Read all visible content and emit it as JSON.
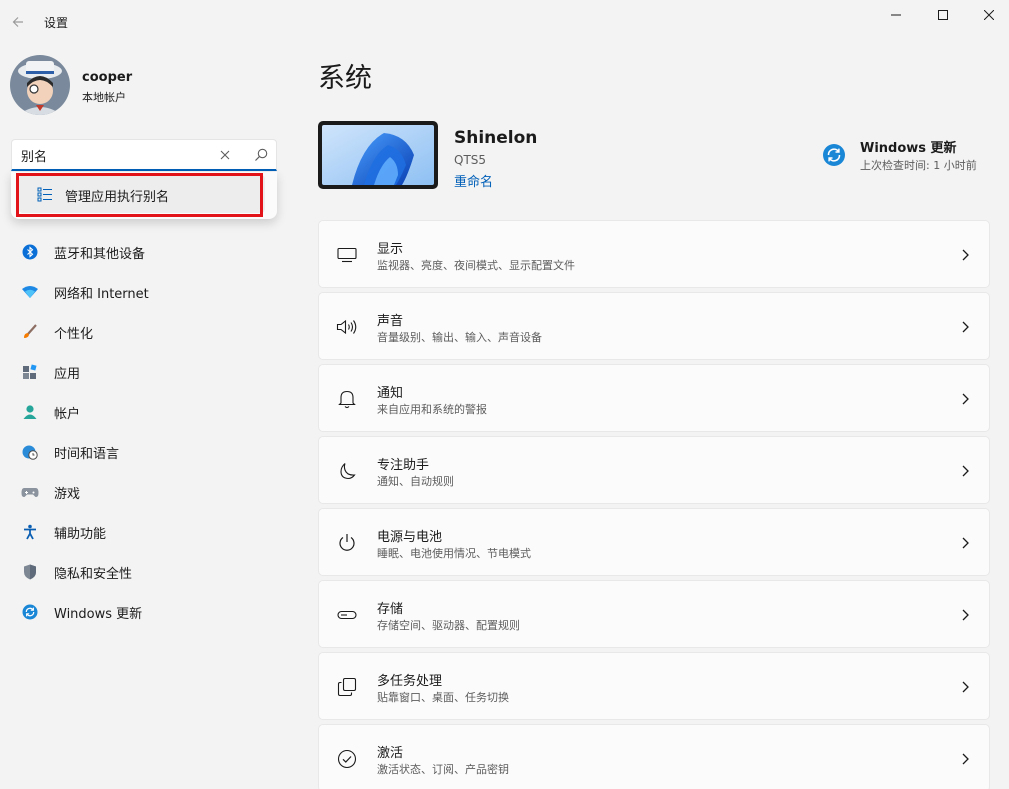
{
  "window": {
    "app_title": "设置"
  },
  "user": {
    "name": "cooper",
    "account_type": "本地帐户"
  },
  "search": {
    "value": "别名",
    "suggestion": "管理应用执行别名"
  },
  "sidebar": {
    "items": [
      {
        "label": "蓝牙和其他设备",
        "icon": "bluetooth-icon"
      },
      {
        "label": "网络和 Internet",
        "icon": "wifi-icon"
      },
      {
        "label": "个性化",
        "icon": "brush-icon"
      },
      {
        "label": "应用",
        "icon": "apps-icon"
      },
      {
        "label": "帐户",
        "icon": "person-icon"
      },
      {
        "label": "时间和语言",
        "icon": "globe-clock-icon"
      },
      {
        "label": "游戏",
        "icon": "gamepad-icon"
      },
      {
        "label": "辅助功能",
        "icon": "accessibility-icon"
      },
      {
        "label": "隐私和安全性",
        "icon": "shield-icon"
      },
      {
        "label": "Windows 更新",
        "icon": "update-icon"
      }
    ]
  },
  "main": {
    "title": "系统",
    "device": {
      "name": "Shinelon",
      "model": "QTS5",
      "rename_label": "重命名"
    },
    "update": {
      "title": "Windows 更新",
      "subtitle": "上次检查时间: 1 小时前"
    },
    "cards": [
      {
        "title": "显示",
        "subtitle": "监视器、亮度、夜间模式、显示配置文件",
        "icon": "monitor-icon"
      },
      {
        "title": "声音",
        "subtitle": "音量级别、输出、输入、声音设备",
        "icon": "speaker-icon"
      },
      {
        "title": "通知",
        "subtitle": "来自应用和系统的警报",
        "icon": "bell-icon"
      },
      {
        "title": "专注助手",
        "subtitle": "通知、自动规则",
        "icon": "moon-icon"
      },
      {
        "title": "电源与电池",
        "subtitle": "睡眠、电池使用情况、节电模式",
        "icon": "power-icon"
      },
      {
        "title": "存储",
        "subtitle": "存储空间、驱动器、配置规则",
        "icon": "storage-icon"
      },
      {
        "title": "多任务处理",
        "subtitle": "贴靠窗口、桌面、任务切换",
        "icon": "multitask-icon"
      },
      {
        "title": "激活",
        "subtitle": "激活状态、订阅、产品密钥",
        "icon": "check-circle-icon"
      }
    ]
  },
  "colors": {
    "accent": "#005fb8",
    "highlight_border": "#e2141a",
    "background": "#f3f3f3",
    "card": "#fbfbfb"
  }
}
